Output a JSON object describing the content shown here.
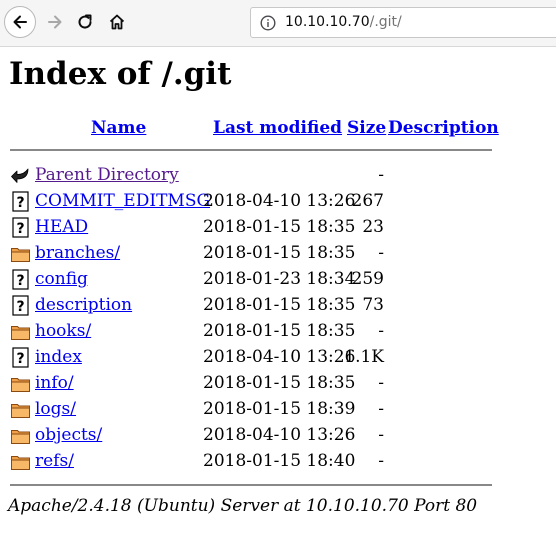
{
  "browser": {
    "url_host": "10.10.10.70",
    "url_path": "/.git/"
  },
  "page": {
    "title": "Index of /.git",
    "headers": {
      "name": "Name",
      "last_modified": "Last modified",
      "size": "Size",
      "description": "Description"
    },
    "parent": {
      "name": "Parent Directory",
      "size": "-",
      "icon": "back-arrow-icon"
    },
    "entries": [
      {
        "name": "COMMIT_EDITMSG",
        "date": "2018-04-10 13:26",
        "size": "267",
        "icon": "unknown-file-icon"
      },
      {
        "name": "HEAD",
        "date": "2018-01-15 18:35",
        "size": "23",
        "icon": "unknown-file-icon"
      },
      {
        "name": "branches/",
        "date": "2018-01-15 18:35",
        "size": "-",
        "icon": "folder-icon"
      },
      {
        "name": "config",
        "date": "2018-01-23 18:34",
        "size": "259",
        "icon": "unknown-file-icon"
      },
      {
        "name": "description",
        "date": "2018-01-15 18:35",
        "size": "73",
        "icon": "unknown-file-icon"
      },
      {
        "name": "hooks/",
        "date": "2018-01-15 18:35",
        "size": "-",
        "icon": "folder-icon"
      },
      {
        "name": "index",
        "date": "2018-04-10 13:26",
        "size": "1.1K",
        "icon": "unknown-file-icon"
      },
      {
        "name": "info/",
        "date": "2018-01-15 18:35",
        "size": "-",
        "icon": "folder-icon"
      },
      {
        "name": "logs/",
        "date": "2018-01-15 18:39",
        "size": "-",
        "icon": "folder-icon"
      },
      {
        "name": "objects/",
        "date": "2018-04-10 13:26",
        "size": "-",
        "icon": "folder-icon"
      },
      {
        "name": "refs/",
        "date": "2018-01-15 18:40",
        "size": "-",
        "icon": "folder-icon"
      }
    ],
    "footer": "Apache/2.4.18 (Ubuntu) Server at 10.10.10.70 Port 80"
  }
}
